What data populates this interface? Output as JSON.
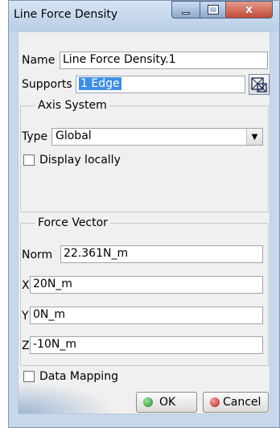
{
  "window": {
    "title": "Line Force Density",
    "controls": {
      "minimize": "minimize",
      "maximize": "maximize",
      "close": "x"
    }
  },
  "name": {
    "label": "Name",
    "value": "Line Force Density.1"
  },
  "supports": {
    "label": "Supports",
    "value": "1 Edge",
    "icon": "edge-selection-icon"
  },
  "axis_system": {
    "title": "Axis System",
    "type_label": "Type",
    "type_value": "Global",
    "display_locally_label": "Display locally",
    "display_locally_checked": false
  },
  "force_vector": {
    "title": "Force Vector",
    "norm_label": "Norm",
    "norm_value": "22.361N_m",
    "x_label": "X",
    "x_value": "20N_m",
    "y_label": "Y",
    "y_value": "0N_m",
    "z_label": "Z",
    "z_value": "-10N_m"
  },
  "data_mapping": {
    "label": "Data Mapping",
    "checked": false
  },
  "buttons": {
    "ok": "OK",
    "cancel": "Cancel"
  },
  "colors": {
    "selection": "#3d8fe6",
    "ok": "#1f8a1f",
    "cancel": "#c21f1f"
  }
}
